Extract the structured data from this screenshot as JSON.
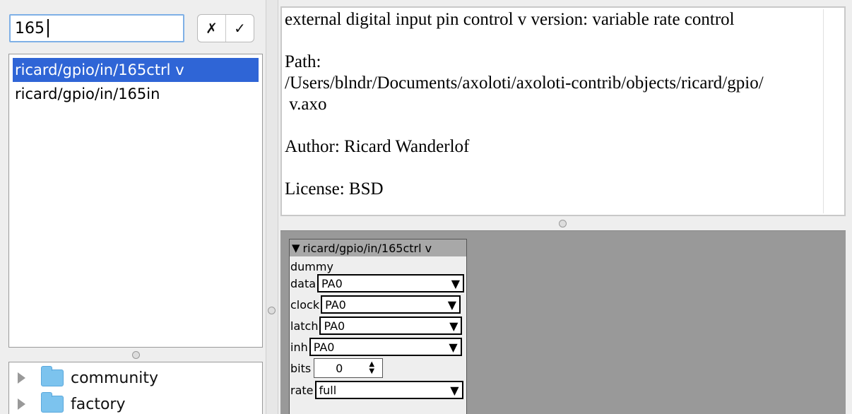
{
  "search": {
    "value": "165"
  },
  "buttons": {
    "cancel": "✗",
    "accept": "✓"
  },
  "results": [
    {
      "label": "ricard/gpio/in/165ctrl v",
      "selected": true
    },
    {
      "label": "ricard/gpio/in/165in",
      "selected": false
    }
  ],
  "tree": [
    {
      "label": "community"
    },
    {
      "label": "factory"
    }
  ],
  "info": {
    "description": "external digital input pin control v version: variable rate control",
    "path_label": "Path:",
    "path_line1": "/Users/blndr/Documents/axoloti/axoloti-contrib/objects/ricard/gpio/",
    "path_line2": " v.axo",
    "author": "Author: Ricard Wanderlof",
    "license": "License: BSD"
  },
  "object": {
    "title": "ricard/gpio/in/165ctrl v",
    "subtitle": "dummy",
    "params": {
      "data": {
        "label": "data",
        "value": "PA0"
      },
      "clock": {
        "label": "clock",
        "value": "PA0"
      },
      "latch": {
        "label": "latch",
        "value": "PA0"
      },
      "inh": {
        "label": "inh",
        "value": "PA0"
      },
      "bits": {
        "label": "bits",
        "value": "0"
      },
      "rate": {
        "label": "rate",
        "value": "full"
      }
    }
  },
  "colors": {
    "selection": "#2f65d6",
    "canvas": "#999999",
    "folder": "#7cc3ee",
    "search_focus": "#7fb0e6"
  },
  "icons": {
    "dropdown_arrow": "▼",
    "collapse_triangle": "▼",
    "spinner_up": "▲",
    "spinner_down": "▼"
  }
}
